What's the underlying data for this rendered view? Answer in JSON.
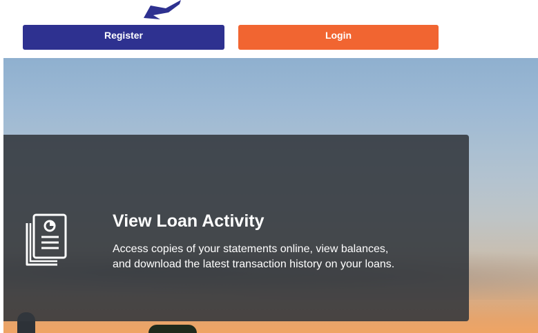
{
  "header": {
    "register_label": "Register",
    "login_label": "Login"
  },
  "feature_card": {
    "title": "View Loan Activity",
    "description_line_1": "Access copies of your statements online, view balances,",
    "description_line_2": "and download the latest transaction history on your loans.",
    "icon": "document-chart-icon"
  },
  "colors": {
    "register_button": "#2e3190",
    "login_button": "#f16531",
    "card_background": "#32373c",
    "annotation_arrow": "#2e3190"
  }
}
